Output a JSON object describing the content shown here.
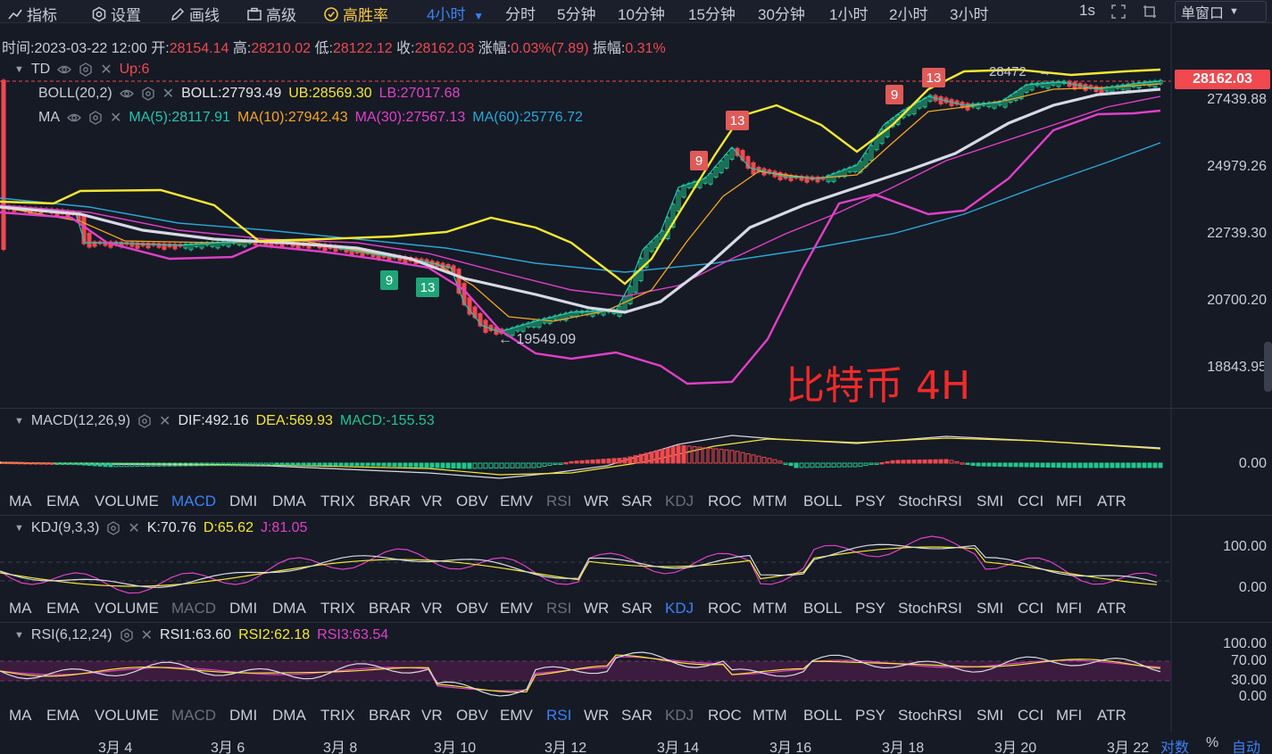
{
  "toolbar": {
    "indicators": "指标",
    "settings": "设置",
    "draw": "画线",
    "advanced": "高级",
    "winrate": "高胜率",
    "timeframe_selected": "4小时",
    "timeframes": [
      "分时",
      "5分钟",
      "10分钟",
      "15分钟",
      "30分钟",
      "1小时",
      "2小时",
      "3小时"
    ],
    "refresh": "1s",
    "window_mode": "单窗口"
  },
  "info": {
    "time_label": "时间:",
    "time": "2023-03-22 12:00",
    "open_label": "开:",
    "open": "28154.14",
    "high_label": "高:",
    "high": "28210.02",
    "low_label": "低:",
    "low": "28122.12",
    "close_label": "收:",
    "close": "28162.03",
    "change_label": "涨幅:",
    "change": "0.03%(7.89)",
    "amp_label": "振幅:",
    "amp": "0.31%"
  },
  "legends": {
    "td": {
      "name": "TD",
      "value": "Up:6"
    },
    "boll": {
      "name": "BOLL(20,2)",
      "boll": "BOLL:27793.49",
      "ub": "UB:28569.30",
      "lb": "LB:27017.68"
    },
    "ma": {
      "name": "MA",
      "ma5": "MA(5):28117.91",
      "ma10": "MA(10):27942.43",
      "ma30": "MA(30):27567.13",
      "ma60": "MA(60):25776.72"
    },
    "macd": {
      "name": "MACD(12,26,9)",
      "dif": "DIF:492.16",
      "dea": "DEA:569.93",
      "macd": "MACD:-155.53"
    },
    "kdj": {
      "name": "KDJ(9,3,3)",
      "k": "K:70.76",
      "d": "D:65.62",
      "j": "J:81.05"
    },
    "rsi": {
      "name": "RSI(6,12,24)",
      "rsi1": "RSI1:63.60",
      "rsi2": "RSI2:62.18",
      "rsi3": "RSI3:63.54"
    }
  },
  "price_axis": [
    "27439.88",
    "24979.26",
    "22739.30",
    "20700.20",
    "18843.95"
  ],
  "last_price": "28162.03",
  "macd_axis": [
    "0.00"
  ],
  "kdj_axis": [
    "100.00",
    "0.00"
  ],
  "rsi_axis": [
    "100.00",
    "70.00",
    "30.00",
    "0.00"
  ],
  "annotations": {
    "high_marker": "28472",
    "low_marker": "← 19549.09",
    "overlay_text": "比特币  4H",
    "td_labels": [
      "9",
      "13",
      "9",
      "13",
      "9",
      "13"
    ]
  },
  "indicator_tabs": [
    "MA",
    "EMA",
    "VOLUME",
    "MACD",
    "DMI",
    "DMA",
    "TRIX",
    "BRAR",
    "VR",
    "OBV",
    "EMV",
    "RSI",
    "WR",
    "SAR",
    "KDJ",
    "ROC",
    "MTM",
    "BOLL",
    "PSY",
    "StochRSI",
    "SMI",
    "CCI",
    "MFI",
    "ATR"
  ],
  "dates": [
    "3月 4",
    "3月 6",
    "3月 8",
    "3月 10",
    "3月 12",
    "3月 14",
    "3月 16",
    "3月 18",
    "3月 20",
    "3月 22"
  ],
  "footer": {
    "log": "对数",
    "pct": "%",
    "auto": "自动"
  },
  "colors": {
    "bg": "#161a25",
    "up": "#22c58b",
    "down": "#f0494f",
    "boll_band": "#f5e830",
    "ma30": "#e040c8",
    "ma60": "#2aa7d6",
    "accent": "#3b82f6"
  }
}
